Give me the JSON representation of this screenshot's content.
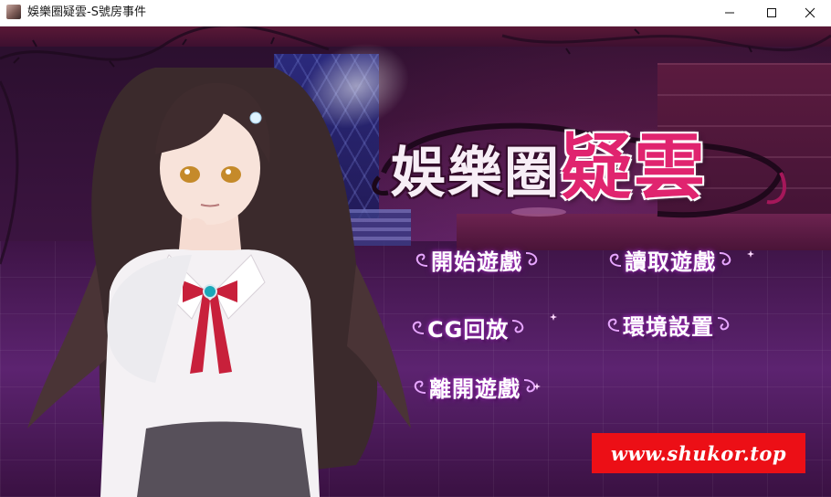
{
  "window": {
    "title": "娛樂圈疑雲-S號房事件",
    "icon": "app-icon",
    "controls": [
      "minimize-icon",
      "maximize-icon",
      "close-icon"
    ]
  },
  "game": {
    "logo": {
      "part1": "娛樂圈",
      "part2": "疑雲"
    },
    "menu": {
      "start_game": "開始遊戲",
      "load_game": "讀取遊戲",
      "cg_gallery": "CG回放",
      "settings": "環境設置",
      "exit_game": "離開遊戲"
    },
    "watermark": "www.shukor.top"
  },
  "colors": {
    "titlebar": "#ffffff",
    "accent_pink": "#e0246f",
    "menu_glow": "#b23bd1",
    "watermark_bg": "#ec0f16"
  }
}
